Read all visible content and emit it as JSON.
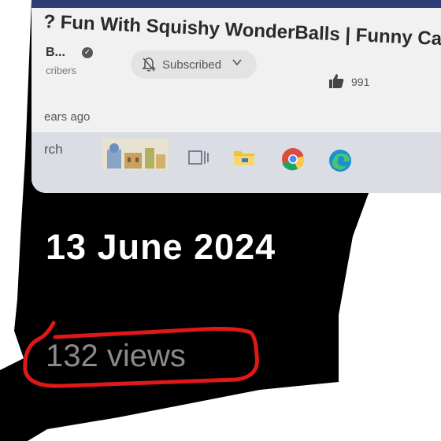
{
  "video": {
    "title": "? Fun With Squishy WonderBalls | Funny Car",
    "channel_name": "B...",
    "subscribers": "cribers",
    "subscribe_label": "Subscribed",
    "likes": "991",
    "uploaded": "ears ago"
  },
  "taskbar": {
    "search_text": "rch",
    "icons": [
      "castle-thumbnail-icon",
      "task-view-icon",
      "file-explorer-icon",
      "chrome-icon",
      "edge-icon"
    ]
  },
  "info": {
    "date": "13 June 2024",
    "views": "132 views"
  },
  "colors": {
    "background": "#000000",
    "annotation_red": "#e01818",
    "date_text": "#ffffff",
    "views_text": "#8a8a8a"
  }
}
